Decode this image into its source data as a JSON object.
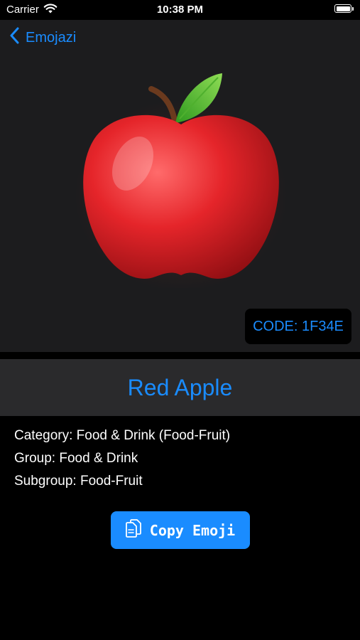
{
  "status_bar": {
    "carrier": "Carrier",
    "time": "10:38 PM"
  },
  "nav": {
    "back_label": "Emojazi"
  },
  "emoji": {
    "code_label": "CODE: 1F34E",
    "name": "Red Apple"
  },
  "details": {
    "category": "Category: Food & Drink (Food-Fruit)",
    "group": "Group: Food & Drink",
    "subgroup": "Subgroup: Food-Fruit"
  },
  "actions": {
    "copy_label": "Copy Emoji"
  },
  "colors": {
    "accent": "#1a8cff",
    "hero_bg": "#1c1c1e",
    "title_band_bg": "#2a2a2c"
  }
}
